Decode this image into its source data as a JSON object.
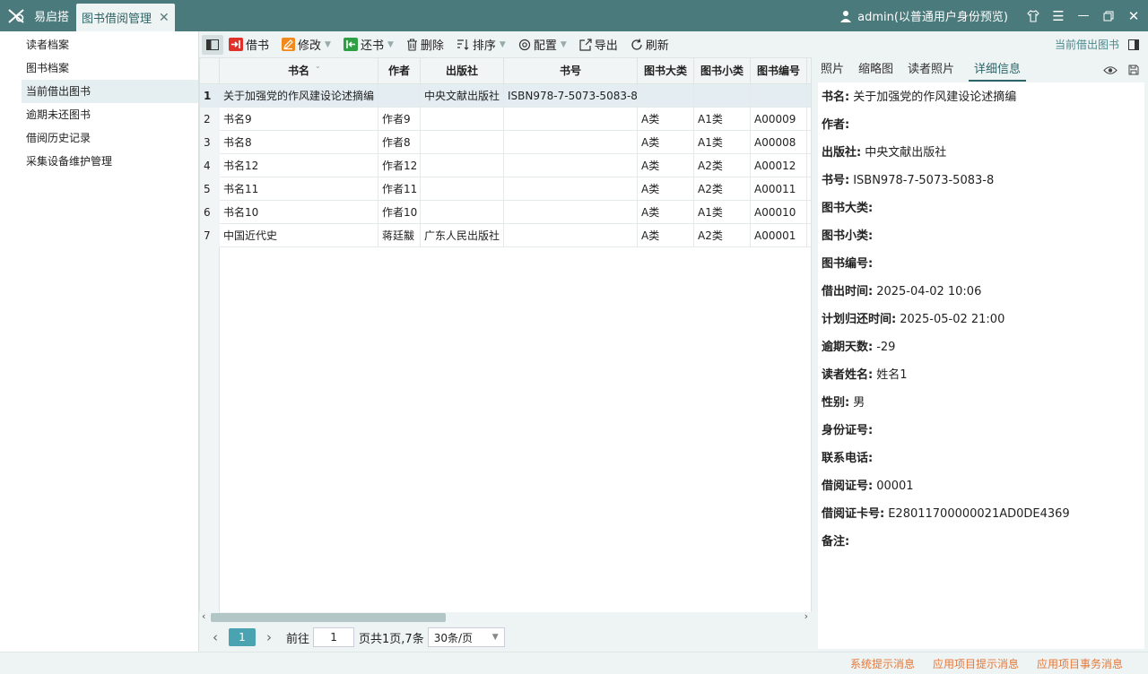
{
  "app": {
    "name": "易启搭",
    "tab": "图书借阅管理",
    "user": "admin(以普通用户身份预览)"
  },
  "sidebar": {
    "items": [
      "读者档案",
      "图书档案",
      "当前借出图书",
      "逾期未还图书",
      "借阅历史记录",
      "采集设备维护管理"
    ]
  },
  "toolbar": {
    "borrow": "借书",
    "edit": "修改",
    "return": "还书",
    "delete": "删除",
    "sort": "排序",
    "config": "配置",
    "export": "导出",
    "refresh": "刷新",
    "right_title": "当前借出图书"
  },
  "table": {
    "columns": [
      "书名",
      "作者",
      "出版社",
      "书号",
      "图书大类",
      "图书小类",
      "图书编号"
    ],
    "rows": [
      {
        "n": "1",
        "title": "关于加强党的作风建设论述摘编",
        "author": "",
        "publisher": "中央文献出版社",
        "isbn": "ISBN978-7-5073-5083-8",
        "cat": "",
        "sub": "",
        "code": ""
      },
      {
        "n": "2",
        "title": "书名9",
        "author": "作者9",
        "publisher": "",
        "isbn": "",
        "cat": "A类",
        "sub": "A1类",
        "code": "A00009"
      },
      {
        "n": "3",
        "title": "书名8",
        "author": "作者8",
        "publisher": "",
        "isbn": "",
        "cat": "A类",
        "sub": "A1类",
        "code": "A00008"
      },
      {
        "n": "4",
        "title": "书名12",
        "author": "作者12",
        "publisher": "",
        "isbn": "",
        "cat": "A类",
        "sub": "A2类",
        "code": "A00012"
      },
      {
        "n": "5",
        "title": "书名11",
        "author": "作者11",
        "publisher": "",
        "isbn": "",
        "cat": "A类",
        "sub": "A2类",
        "code": "A00011"
      },
      {
        "n": "6",
        "title": "书名10",
        "author": "作者10",
        "publisher": "",
        "isbn": "",
        "cat": "A类",
        "sub": "A1类",
        "code": "A00010"
      },
      {
        "n": "7",
        "title": "中国近代史",
        "author": "蒋廷黻",
        "publisher": "广东人民出版社",
        "isbn": "",
        "cat": "A类",
        "sub": "A2类",
        "code": "A00001"
      }
    ]
  },
  "pager": {
    "current": "1",
    "goto_label": "前往",
    "goto_value": "1",
    "info": "页共1页,7条",
    "page_size": "30条/页"
  },
  "right_panel": {
    "tabs": [
      "照片",
      "缩略图",
      "读者照片",
      "详细信息"
    ],
    "details": [
      {
        "label": "书名:",
        "value": "关于加强党的作风建设论述摘编"
      },
      {
        "label": "作者:",
        "value": ""
      },
      {
        "label": "出版社:",
        "value": "中央文献出版社"
      },
      {
        "label": "书号:",
        "value": "ISBN978-7-5073-5083-8"
      },
      {
        "label": "图书大类:",
        "value": ""
      },
      {
        "label": "图书小类:",
        "value": ""
      },
      {
        "label": "图书编号:",
        "value": ""
      },
      {
        "label": "借出时间:",
        "value": "2025-04-02 10:06"
      },
      {
        "label": "计划归还时间:",
        "value": "2025-05-02 21:00"
      },
      {
        "label": "逾期天数:",
        "value": "-29"
      },
      {
        "label": "读者姓名:",
        "value": "姓名1"
      },
      {
        "label": "性别:",
        "value": "男"
      },
      {
        "label": "身份证号:",
        "value": ""
      },
      {
        "label": "联系电话:",
        "value": ""
      },
      {
        "label": "借阅证号:",
        "value": "00001"
      },
      {
        "label": "借阅证卡号:",
        "value": "E28011700000021AD0DE4369"
      },
      {
        "label": "备注:",
        "value": ""
      }
    ]
  },
  "statusbar": {
    "items": [
      "系统提示消息",
      "应用项目提示消息",
      "应用项目事务消息"
    ]
  }
}
